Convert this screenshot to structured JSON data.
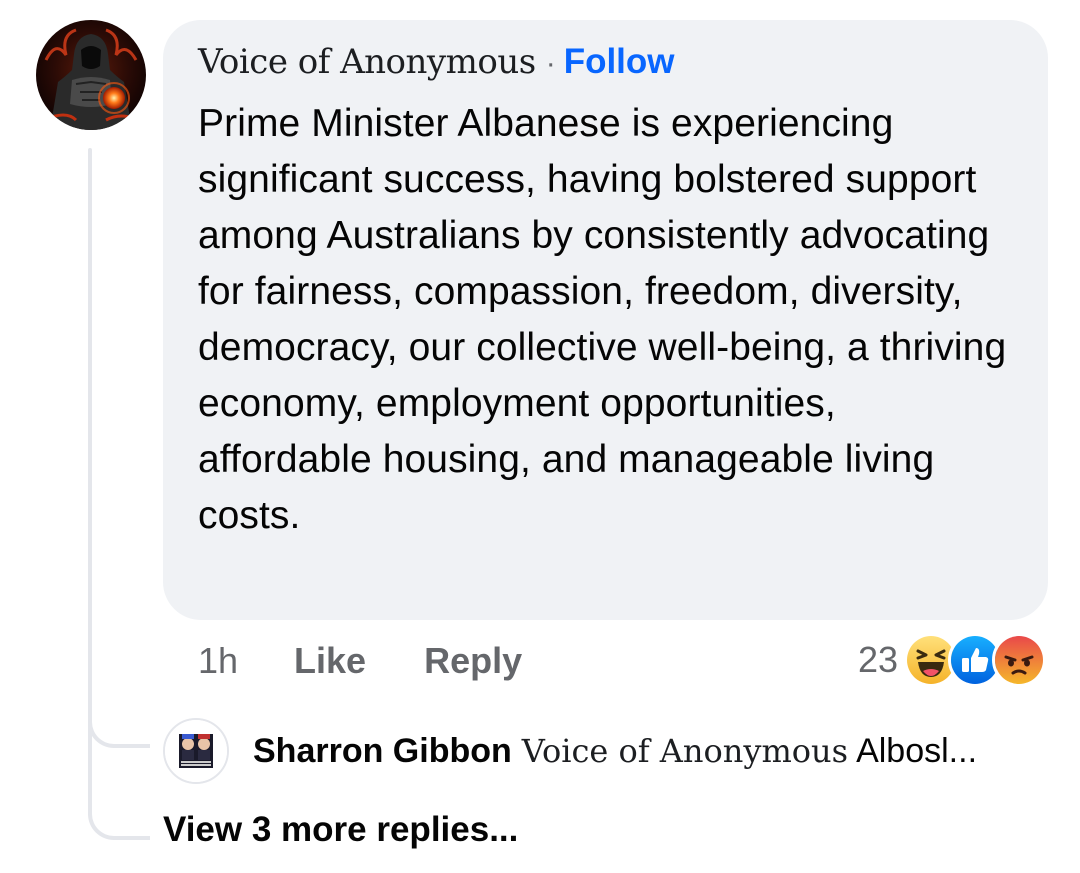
{
  "comment": {
    "author": "Voice of Anonymous",
    "separator": "·",
    "follow_label": "Follow",
    "text": "Prime Minister Albanese is experiencing significant success, having bolstered support among Australians by consistently advocating for fairness, compassion, freedom, diversity, democracy, our collective well-being, a thriving economy, employment opportunities, affordable housing, and manageable living costs.",
    "time": "1h",
    "like_label": "Like",
    "reply_label": "Reply",
    "reaction_count": "23",
    "reactions": [
      "haha-icon",
      "like-icon",
      "angry-icon"
    ]
  },
  "reply": {
    "author": "Sharron Gibbon",
    "tag": "Voice of Anonymous",
    "snippet": "Albosl..."
  },
  "view_more_label": "View 3 more replies...",
  "colors": {
    "bubble": "#f0f2f5",
    "link_blue": "#0866ff",
    "secondary_text": "#65676b",
    "thread_line": "#e4e6eb"
  }
}
